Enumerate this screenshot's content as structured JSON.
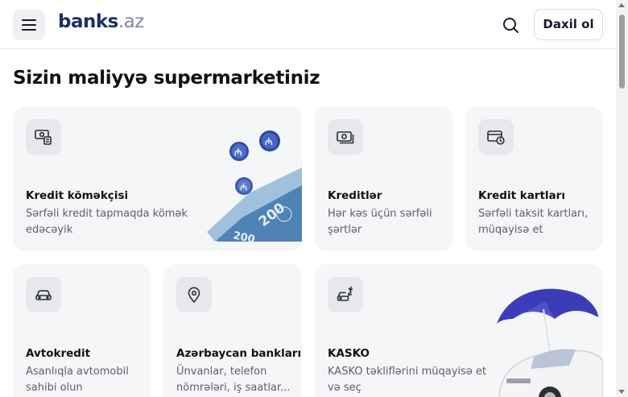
{
  "header": {
    "logo_main": "banks",
    "logo_suffix": ".az",
    "login_label": "Daxil ol"
  },
  "page": {
    "title": "Sizin maliyyə supermarketiniz"
  },
  "cards": [
    {
      "title": "Kredit köməkçisi",
      "desc": "Sərfəli kredit tapmaqda kömək edəcəyik",
      "icon": "credit-helper-icon"
    },
    {
      "title": "Kreditlər",
      "desc": "Hər kəs üçün sərfəli şərtlər",
      "icon": "cash-icon"
    },
    {
      "title": "Kredit kartları",
      "desc": "Sərfəli taksit kartları, müqayisə et",
      "icon": "credit-card-clock-icon"
    },
    {
      "title": "Avtokredit",
      "desc": "Asanlıqla avtomobil sahibi olun",
      "icon": "car-icon"
    },
    {
      "title": "Azərbaycan bankları",
      "desc": "Ünvanlar, telefon nömrələri, iş saatlar...",
      "icon": "location-pin-icon"
    },
    {
      "title": "KASKO",
      "desc": "KASKO təkliflərini müqayisə et və seç",
      "icon": "car-insurance-icon"
    }
  ],
  "colors": {
    "brand": "#1c2f6b",
    "card_bg": "#f5f6f8",
    "icon_bg": "#e6e8ec",
    "coin_blue": "#2f4fa8",
    "umbrella": "#3b3db8"
  }
}
